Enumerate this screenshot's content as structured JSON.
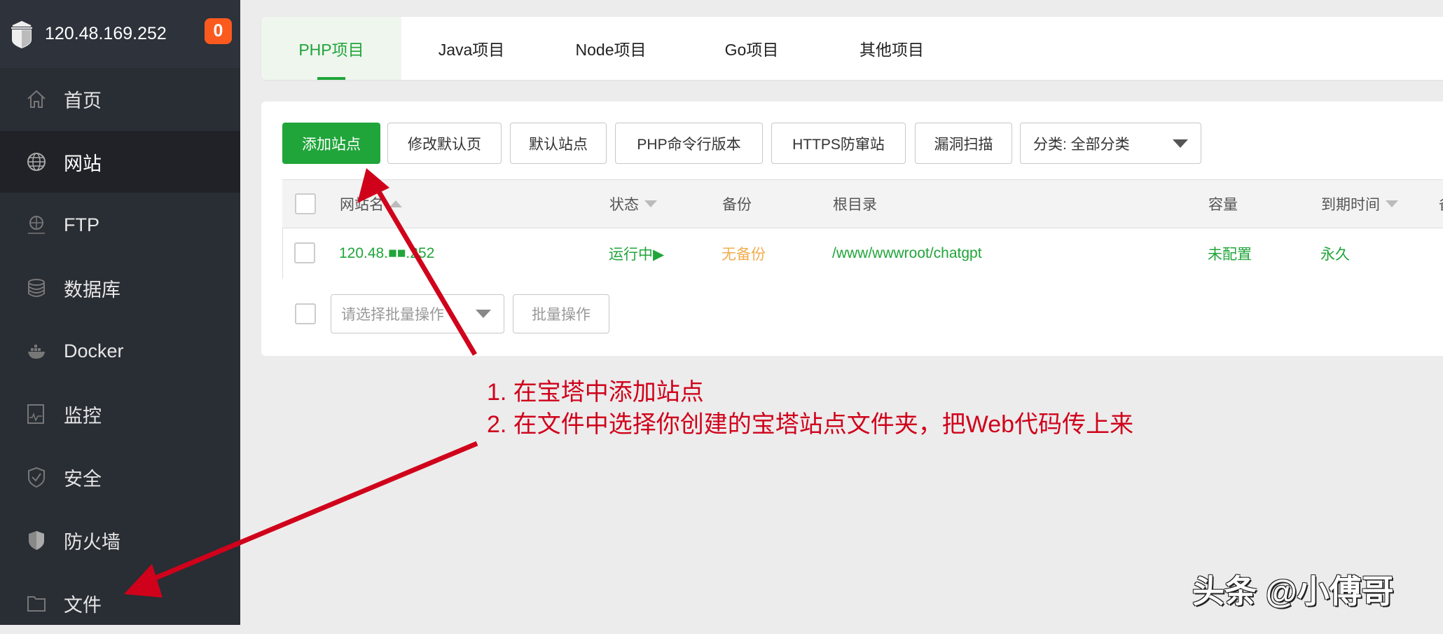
{
  "sidebar": {
    "server_ip": "120.48.169.252",
    "notification_count": "0",
    "items": [
      {
        "label": "首页",
        "icon": "home-icon"
      },
      {
        "label": "网站",
        "icon": "globe-icon",
        "active": true
      },
      {
        "label": "FTP",
        "icon": "ftp-icon"
      },
      {
        "label": "数据库",
        "icon": "database-icon"
      },
      {
        "label": "Docker",
        "icon": "docker-icon"
      },
      {
        "label": "监控",
        "icon": "monitor-icon"
      },
      {
        "label": "安全",
        "icon": "shield-check-icon"
      },
      {
        "label": "防火墙",
        "icon": "firewall-icon"
      },
      {
        "label": "文件",
        "icon": "folder-icon"
      }
    ]
  },
  "tabs": [
    "PHP项目",
    "Java项目",
    "Node项目",
    "Go项目",
    "其他项目"
  ],
  "toolbar": {
    "add_site": "添加站点",
    "edit_default_page": "修改默认页",
    "default_site": "默认站点",
    "php_cli_version": "PHP命令行版本",
    "https_anti_hijack": "HTTPS防窜站",
    "vuln_scan": "漏洞扫描",
    "category_select": "分类: 全部分类"
  },
  "table": {
    "headers": [
      "网站名",
      "状态",
      "备份",
      "根目录",
      "容量",
      "到期时间",
      "备注"
    ],
    "rows": [
      {
        "name": "120.48.■■.252",
        "status": "运行中▶",
        "backup": "无备份",
        "root": "/www/wwwroot/chatgpt",
        "quota": "未配置",
        "expiry": "永久"
      }
    ]
  },
  "batch": {
    "placeholder": "请选择批量操作",
    "button": "批量操作"
  },
  "annotations": [
    "1. 在宝塔中添加站点",
    "2. 在文件中选择你创建的宝塔站点文件夹，把Web代码传上来"
  ],
  "watermark": "头条 @小傅哥",
  "colors": {
    "accent": "#20a53a",
    "badge": "#fa5a1e",
    "annotation": "#d0021b",
    "sidebar": "#292d34"
  }
}
